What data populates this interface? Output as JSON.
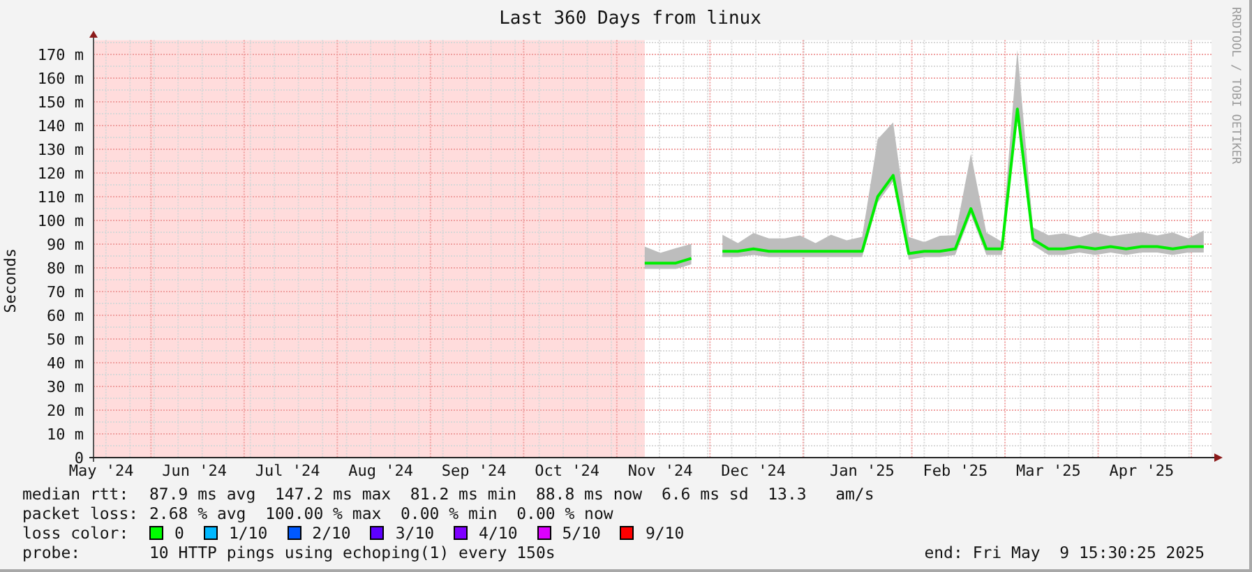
{
  "title": "Last 360 Days from linux",
  "credit": "RRDTOOL / TOBI OETIKER",
  "chart_data": {
    "type": "line",
    "grid": true,
    "ylabel": "Seconds",
    "ylim": [
      0,
      176
    ],
    "yticks": [
      {
        "value": 0,
        "label": "0"
      },
      {
        "value": 10,
        "label": "10 m"
      },
      {
        "value": 20,
        "label": "20 m"
      },
      {
        "value": 30,
        "label": "30 m"
      },
      {
        "value": 40,
        "label": "40 m"
      },
      {
        "value": 50,
        "label": "50 m"
      },
      {
        "value": 60,
        "label": "60 m"
      },
      {
        "value": 70,
        "label": "70 m"
      },
      {
        "value": 80,
        "label": "80 m"
      },
      {
        "value": 90,
        "label": "90 m"
      },
      {
        "value": 100,
        "label": "100 m"
      },
      {
        "value": 110,
        "label": "110 m"
      },
      {
        "value": 120,
        "label": "120 m"
      },
      {
        "value": 130,
        "label": "130 m"
      },
      {
        "value": 140,
        "label": "140 m"
      },
      {
        "value": 150,
        "label": "150 m"
      },
      {
        "value": 160,
        "label": "160 m"
      },
      {
        "value": 170,
        "label": "170 m"
      }
    ],
    "categories": [
      "May '24",
      null,
      null,
      null,
      null,
      null,
      "Jun '24",
      null,
      null,
      null,
      null,
      null,
      "Jul '24",
      null,
      null,
      null,
      null,
      null,
      "Aug '24",
      null,
      null,
      null,
      null,
      null,
      "Sep '24",
      null,
      null,
      null,
      null,
      null,
      "Oct '24",
      null,
      null,
      null,
      null,
      null,
      "Nov '24",
      null,
      null,
      null,
      null,
      null,
      "Dec '24",
      null,
      null,
      null,
      null,
      null,
      null,
      "Jan '25",
      null,
      null,
      null,
      null,
      null,
      "Feb '25",
      null,
      null,
      null,
      null,
      null,
      "Mar '25",
      null,
      null,
      null,
      null,
      null,
      "Apr '25",
      null,
      null,
      null,
      null
    ],
    "series": [
      {
        "name": "median rtt:",
        "color": "#00ee00",
        "values": [
          null,
          null,
          null,
          null,
          null,
          null,
          null,
          null,
          null,
          null,
          null,
          null,
          null,
          null,
          null,
          null,
          null,
          null,
          null,
          null,
          null,
          null,
          null,
          null,
          null,
          null,
          null,
          null,
          null,
          null,
          null,
          null,
          null,
          null,
          null,
          82,
          82,
          82,
          84,
          null,
          87,
          87,
          88,
          87,
          87,
          87,
          87,
          87,
          87,
          87,
          110,
          119,
          86,
          87,
          87,
          88,
          105,
          88,
          88,
          147,
          92,
          88,
          88,
          89,
          88,
          89,
          88,
          89,
          89,
          88,
          89,
          89
        ]
      }
    ]
  },
  "median_rtt": {
    "text": "87.9 ms avg  147.2 ms max  81.2 ms min  88.8 ms now  6.6 ms sd  13.3   am/s"
  },
  "packet_loss": {
    "label": "packet loss:",
    "text": "2.68 % avg  100.00 % max  0.00 % min  0.00 % now"
  },
  "loss_color": {
    "label": "loss color:",
    "items": [
      {
        "label": "0",
        "color": "#00ff00"
      },
      {
        "label": "1/10",
        "color": "#00b8ff"
      },
      {
        "label": "2/10",
        "color": "#0059ff"
      },
      {
        "label": "3/10",
        "color": "#5e00ff"
      },
      {
        "label": "4/10",
        "color": "#7e00ff"
      },
      {
        "label": "5/10",
        "color": "#dd00ff"
      },
      {
        "label": "9/10",
        "color": "#ff0000"
      }
    ]
  },
  "probe": {
    "label": "probe:",
    "text": "10 HTTP pings using echoping(1) every 150s"
  },
  "end": "end: Fri May  9 15:30:25 2025"
}
